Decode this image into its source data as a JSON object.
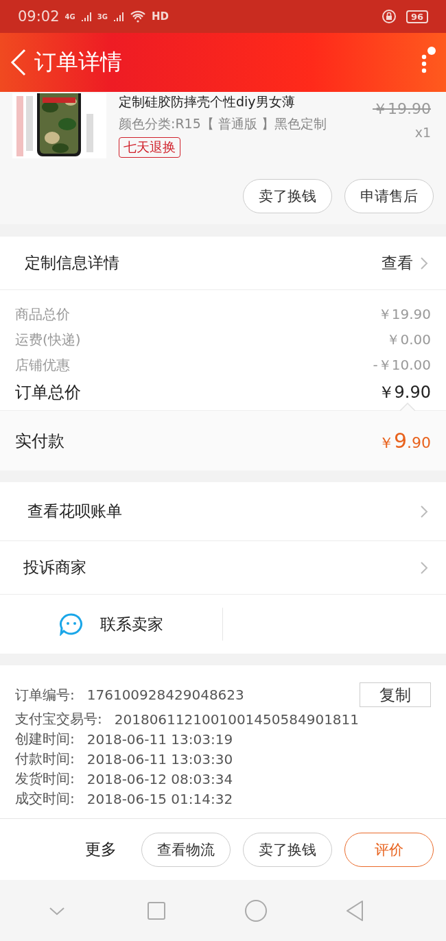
{
  "status_bar": {
    "time": "09:02",
    "network_1": "4G",
    "network_2": "3G",
    "hd": "HD",
    "battery": "96"
  },
  "header": {
    "title": "订单详情",
    "menu_badge": true
  },
  "product": {
    "kind": "picture",
    "title": "定制硅胶防摔壳个性diy男女薄",
    "variant": "颜色分类:R15【 普通版 】黑色定制",
    "tag": "七天退换",
    "price": "￥19.90",
    "quantity": "x1"
  },
  "product_actions": [
    "卖了换钱",
    "申请售后"
  ],
  "custom_info": {
    "label": "定制信息详情",
    "action": "查看"
  },
  "price_rows": [
    {
      "label": "商品总价",
      "value": "￥19.90"
    },
    {
      "label": "运费(快递)",
      "value": "￥0.00"
    },
    {
      "label": "店铺优惠",
      "value": "-￥10.00"
    }
  ],
  "order_total": {
    "label": "订单总价",
    "value": "￥9.90"
  },
  "paid": {
    "label": "实付款",
    "currency": "￥",
    "integer": "9",
    "decimal": ".90"
  },
  "links": [
    {
      "label": "查看花呗账单"
    },
    {
      "label": "投诉商家"
    }
  ],
  "contact": {
    "label": "联系卖家"
  },
  "order_info": [
    {
      "label": "订单编号:",
      "value": "176100928429048623"
    },
    {
      "label": "支付宝交易号:",
      "value": "2018061121001001450584901811"
    },
    {
      "label": "创建时间:",
      "value": "2018-06-11 13:03:19"
    },
    {
      "label": "付款时间:",
      "value": "2018-06-11 13:03:30"
    },
    {
      "label": "发货时间:",
      "value": "2018-06-12 08:03:34"
    },
    {
      "label": "成交时间:",
      "value": "2018-06-15 01:14:32"
    }
  ],
  "copy_button": "复制",
  "bottom_bar": {
    "more": "更多",
    "buttons": [
      {
        "label": "查看物流",
        "primary": false
      },
      {
        "label": "卖了换钱",
        "primary": false
      },
      {
        "label": "评价",
        "primary": true
      }
    ]
  }
}
